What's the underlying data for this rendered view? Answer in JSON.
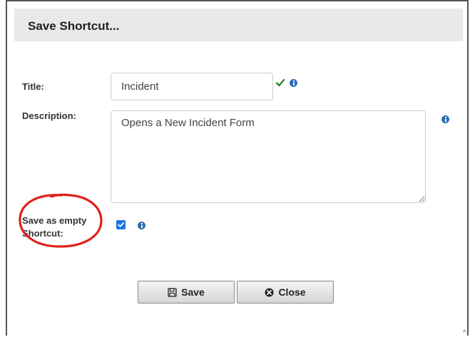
{
  "dialog": {
    "title": "Save Shortcut..."
  },
  "form": {
    "title_label": "Title:",
    "title_value": "Incident",
    "description_label": "Description:",
    "description_value": "Opens a New Incident Form",
    "empty_shortcut_label_line1": "Save as empty",
    "empty_shortcut_label_line2": "Shortcut:",
    "empty_shortcut_checked": true
  },
  "buttons": {
    "save_label": "Save",
    "close_label": "Close"
  },
  "icons": {
    "valid": "checkmark-icon",
    "info": "info-icon",
    "save": "floppy-disk-icon",
    "close": "circle-x-icon"
  },
  "colors": {
    "info_blue": "#2f6db5",
    "valid_green": "#2e8b2e",
    "checkbox_blue": "#1a73e8",
    "annotation_red": "#e0201c",
    "header_bg": "#e9e9e9"
  }
}
